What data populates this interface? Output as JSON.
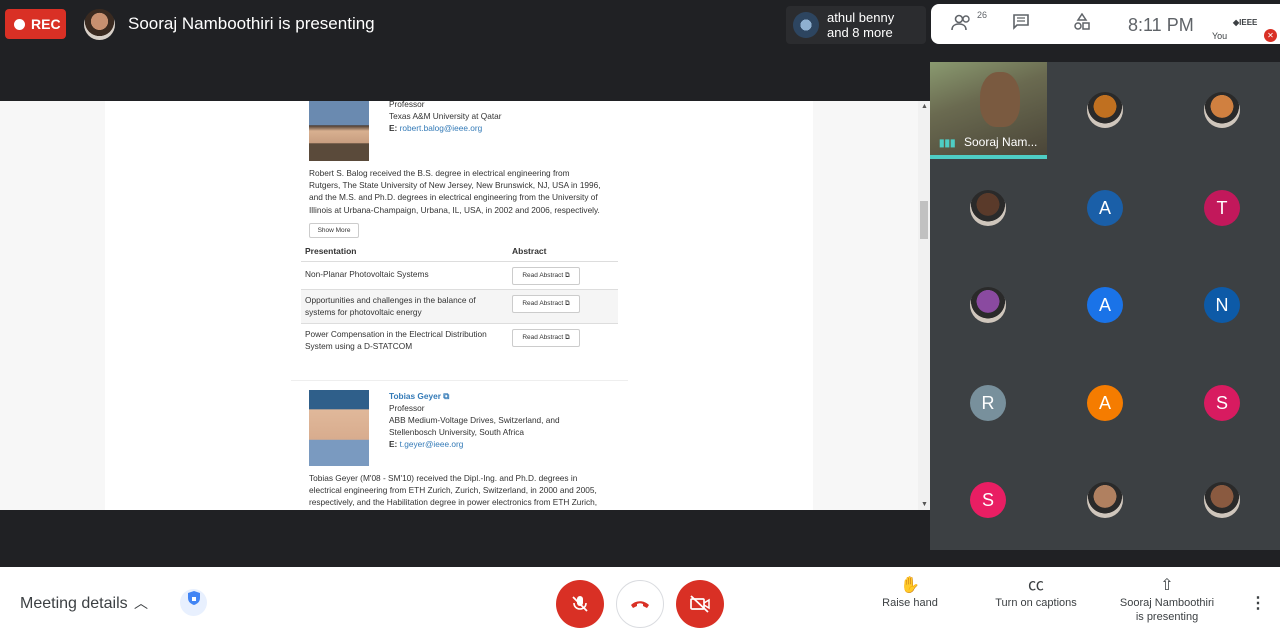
{
  "topbar": {
    "rec_label": "REC",
    "presenting_title": "Sooraj Namboothiri is presenting",
    "others_line1": "athul benny",
    "others_line2": "and 8 more",
    "participant_count": "26",
    "time": "8:11 PM",
    "org_logo": "◆IEEE",
    "self_label": "You"
  },
  "share": {
    "person1": {
      "role": "Professor",
      "affiliation": "Texas A&M University at Qatar",
      "email_prefix": "E:",
      "email": "robert.balog@ieee.org",
      "bio_lines": [
        "Robert S. Balog received the B.S. degree in electrical engineering from",
        "Rutgers, The State University of New Jersey, New Brunswick, NJ, USA in 1996,",
        "and the M.S. and Ph.D. degrees in electrical engineering from the University of",
        "Illinois at Urbana-Champaign, Urbana, IL, USA, in 2002 and 2006, respectively."
      ],
      "show_more": "Show More"
    },
    "table": {
      "col_presentation": "Presentation",
      "col_abstract": "Abstract",
      "rows": [
        {
          "title1": "Non-Planar Photovoltaic Systems",
          "title2": "",
          "button": "Read Abstract"
        },
        {
          "title1": "Opportunities and challenges in the balance of",
          "title2": "systems for photovoltaic energy",
          "button": "Read Abstract"
        },
        {
          "title1": "Power Compensation in the Electrical Distribution",
          "title2": "System using a D-STATCOM",
          "button": "Read Abstract"
        }
      ]
    },
    "person2": {
      "name": "Tobias Geyer",
      "role": "Professor",
      "affiliation1": "ABB Medium-Voltage Drives, Switzerland, and",
      "affiliation2": "Stellenbosch University, South Africa",
      "email_prefix": "E:",
      "email": "t.geyer@ieee.org",
      "bio_lines": [
        "Tobias Geyer (M'08 - SM'10) received the Dipl.-Ing. and Ph.D. degrees in",
        "electrical engineering from ETH Zurich, Zurich, Switzerland, in 2000 and 2005,",
        "respectively, and the Habilitation degree in power electronics from ETH Zurich,"
      ]
    }
  },
  "participants": {
    "self_name": "Sooraj Nam...",
    "tiles": [
      {
        "letter": "",
        "color": "#c07020",
        "kind": "photo"
      },
      {
        "letter": "",
        "color": "#d08040",
        "kind": "photo"
      },
      {
        "letter": "",
        "color": "#5a3a2a",
        "kind": "photo"
      },
      {
        "letter": "A",
        "color": "#1a5fa8",
        "kind": "letter"
      },
      {
        "letter": "T",
        "color": "#c2185b",
        "kind": "letter"
      },
      {
        "letter": "",
        "color": "#8a4aa0",
        "kind": "photo"
      },
      {
        "letter": "A",
        "color": "#1a73e8",
        "kind": "letter"
      },
      {
        "letter": "N",
        "color": "#0d5aa7",
        "kind": "letter"
      },
      {
        "letter": "R",
        "color": "#78909c",
        "kind": "letter"
      },
      {
        "letter": "A",
        "color": "#f57c00",
        "kind": "letter"
      },
      {
        "letter": "S",
        "color": "#d81b60",
        "kind": "letter"
      },
      {
        "letter": "S",
        "color": "#e91e63",
        "kind": "letter"
      },
      {
        "letter": "",
        "color": "#b08060",
        "kind": "photo"
      },
      {
        "letter": "",
        "color": "#8a5a40",
        "kind": "photo"
      }
    ]
  },
  "bottombar": {
    "meeting_details": "Meeting details",
    "raise_hand": "Raise hand",
    "captions": "Turn on captions",
    "presenting_line1": "Sooraj Namboothiri",
    "presenting_line2": "is presenting"
  }
}
